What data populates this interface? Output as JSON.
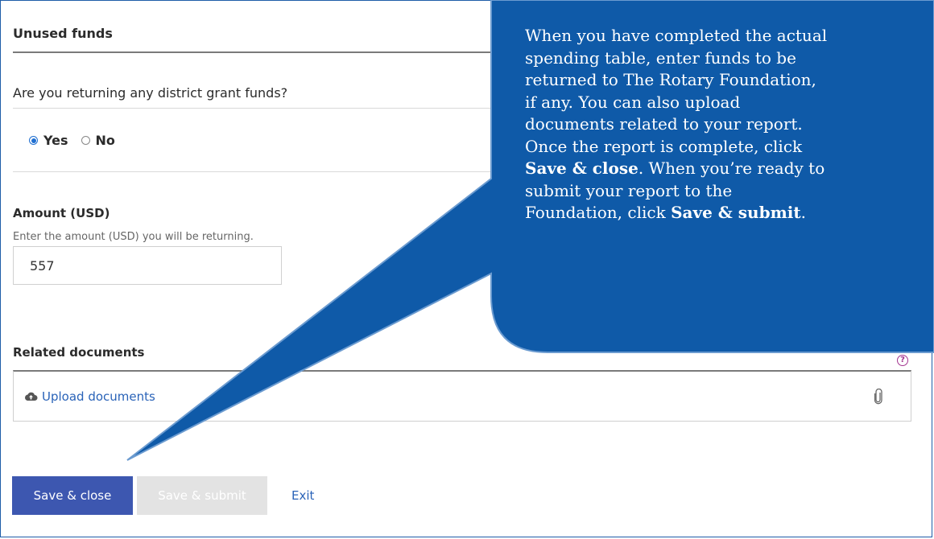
{
  "sections": {
    "unused_funds": "Unused funds",
    "question": "Are you returning any district grant funds?",
    "amount_label": "Amount (USD)",
    "amount_help": "Enter the amount (USD) you will be returning.",
    "related_docs": "Related documents"
  },
  "radios": {
    "yes": "Yes",
    "no": "No",
    "selected": "Yes"
  },
  "amount": {
    "value": "557"
  },
  "docs": {
    "upload_label": "Upload documents",
    "help_glyph": "?"
  },
  "buttons": {
    "save_close": "Save & close",
    "save_submit": "Save & submit",
    "exit": "Exit"
  },
  "callout": {
    "line1": "When you have completed the actual",
    "line2": "spending table, enter funds to be",
    "line3": "returned to The Rotary Foundation,",
    "line4": "if any. You can also upload",
    "line5": "documents related to your report.",
    "line6": "Once the report is complete, click",
    "line7_bold": "Save & close",
    "line7_rest": ". When you’re ready to",
    "line8": "submit your report to the",
    "line9_pre": "Foundation, click ",
    "line9_bold": "Save & submit",
    "line9_end": "."
  },
  "colors": {
    "callout_fill": "#0f5aa8",
    "primary_button": "#3d57b0",
    "link": "#2a63b8",
    "help_icon": "#a3338f"
  },
  "icons": [
    "cloud-upload-icon",
    "paperclip-icon",
    "help-icon"
  ]
}
